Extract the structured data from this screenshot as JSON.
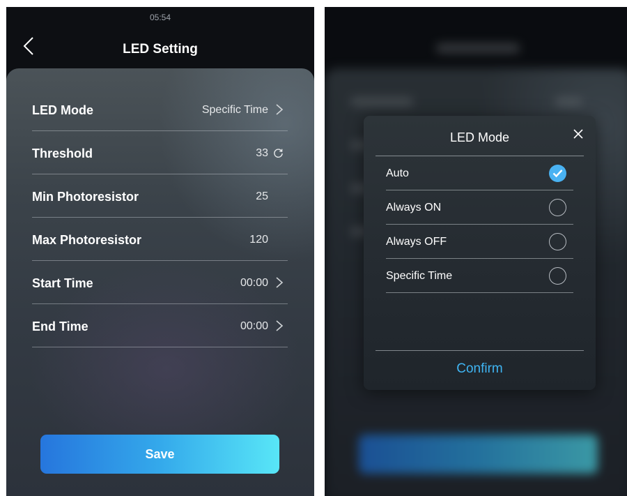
{
  "left_screen": {
    "status_time": "05:54",
    "title": "LED Setting",
    "rows": [
      {
        "label": "LED Mode",
        "value": "Specific Time",
        "control": "chevron-right-icon"
      },
      {
        "label": "Threshold",
        "value": "33",
        "control": "refresh-icon"
      },
      {
        "label": "Min Photoresistor",
        "value": "25",
        "control": ""
      },
      {
        "label": "Max Photoresistor",
        "value": "120",
        "control": ""
      },
      {
        "label": "Start Time",
        "value": "00:00",
        "control": "chevron-right-icon"
      },
      {
        "label": "End Time",
        "value": "00:00",
        "control": "chevron-right-icon"
      }
    ],
    "save_label": "Save"
  },
  "right_screen": {
    "dialog": {
      "title": "LED Mode",
      "options": [
        {
          "label": "Auto",
          "selected": true
        },
        {
          "label": "Always ON",
          "selected": false
        },
        {
          "label": "Always OFF",
          "selected": false
        },
        {
          "label": "Specific Time",
          "selected": false
        }
      ],
      "confirm_label": "Confirm"
    }
  },
  "colors": {
    "accent": "#3fb4f2",
    "button_gradient_start": "#2676dd",
    "button_gradient_end": "#58e6f7",
    "background": "#0d0f13"
  }
}
